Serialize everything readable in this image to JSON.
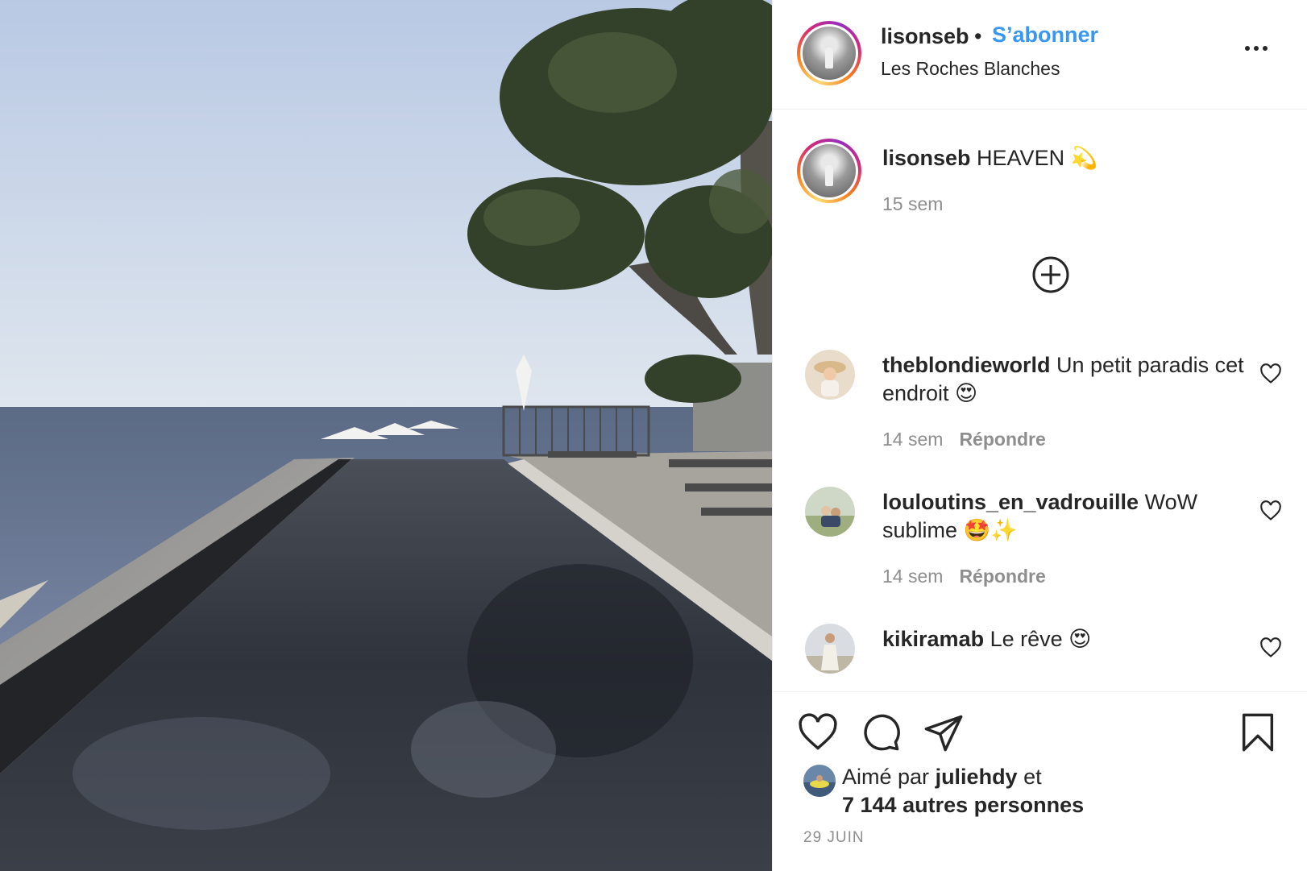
{
  "post": {
    "author": "lisonseb",
    "separator": "•",
    "follow_label": "S’abonner",
    "location": "Les Roches Blanches",
    "caption_text": "HEAVEN 💫",
    "caption_time": "15 sem"
  },
  "comments": [
    {
      "user": "theblondieworld",
      "text": "Un petit paradis cet endroit 😍",
      "time": "14 sem",
      "reply_label": "Répondre"
    },
    {
      "user": "louloutins_en_vadrouille",
      "text": "WoW sublime 🤩✨",
      "time": "14 sem",
      "reply_label": "Répondre"
    },
    {
      "user": "kikiramab",
      "text": "Le rêve 😍"
    }
  ],
  "likes": {
    "prefix": "Aimé par",
    "user": "juliehdy",
    "suffix": "et",
    "others": "7 144 autres personnes"
  },
  "date": "29 JUIN",
  "colors": {
    "accent": "#3897f0",
    "text": "#262626",
    "muted": "#8e8e8e",
    "border": "#efefef"
  },
  "icons": [
    "more-options-icon",
    "load-more-comments-icon",
    "comment-like-icon",
    "like-icon",
    "comment-icon",
    "share-icon",
    "save-icon"
  ]
}
